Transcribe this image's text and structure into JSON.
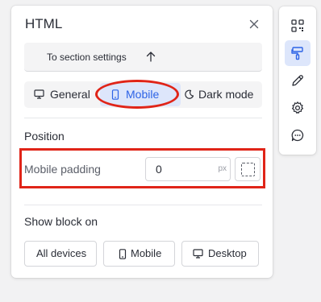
{
  "panel": {
    "title": "HTML",
    "section_settings_label": "To section settings"
  },
  "tabs": [
    {
      "label": "General",
      "icon": "monitor-icon"
    },
    {
      "label": "Mobile",
      "icon": "smartphone-icon",
      "active": true
    },
    {
      "label": "Dark mode",
      "icon": "moon-icon"
    }
  ],
  "position": {
    "heading": "Position",
    "mobile_padding_label": "Mobile padding",
    "mobile_padding_value": "0",
    "unit": "px"
  },
  "show_block": {
    "heading": "Show block on",
    "options": [
      {
        "label": "All devices"
      },
      {
        "label": "Mobile",
        "icon": "smartphone-icon"
      },
      {
        "label": "Desktop",
        "icon": "monitor-icon"
      }
    ]
  },
  "toolbar": [
    {
      "icon": "qr-code-icon"
    },
    {
      "icon": "paint-roller-icon",
      "active": true
    },
    {
      "icon": "pencil-icon"
    },
    {
      "icon": "gear-icon"
    },
    {
      "icon": "chat-bubble-icon"
    }
  ],
  "colors": {
    "accent": "#2d63e6",
    "accent_bg": "#dde6fb",
    "annotation_red": "#e02418"
  }
}
